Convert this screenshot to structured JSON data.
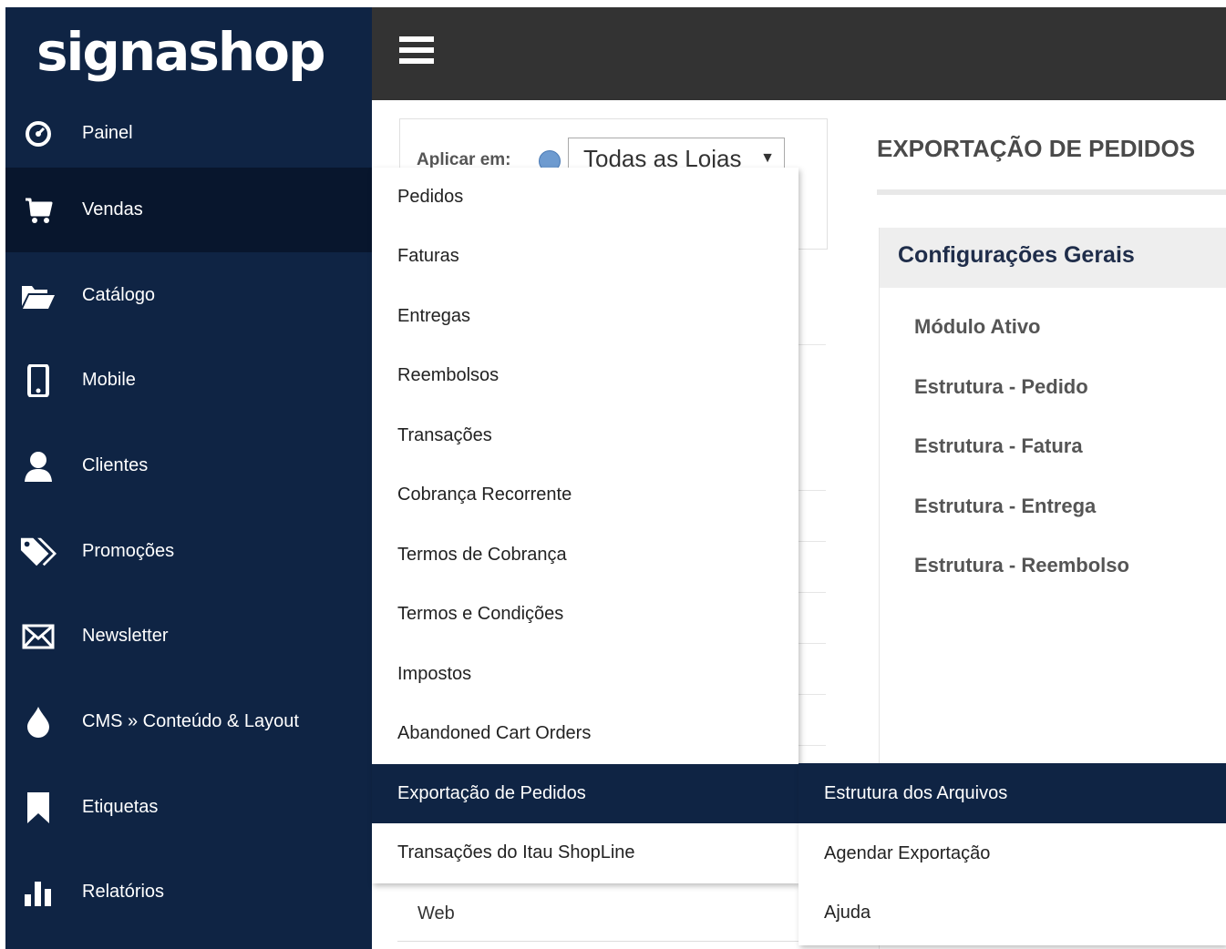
{
  "brand": {
    "logo": "signashop"
  },
  "sidebar": {
    "items": [
      {
        "label": "Painel",
        "icon": "dashboard-icon"
      },
      {
        "label": "Vendas",
        "icon": "cart-icon",
        "active": true
      },
      {
        "label": "Catálogo",
        "icon": "folder-icon"
      },
      {
        "label": "Mobile",
        "icon": "mobile-icon"
      },
      {
        "label": "Clientes",
        "icon": "user-icon"
      },
      {
        "label": "Promoções",
        "icon": "tags-icon"
      },
      {
        "label": "Newsletter",
        "icon": "envelope-icon"
      },
      {
        "label": "CMS » Conteúdo & Layout",
        "icon": "drop-icon"
      },
      {
        "label": "Etiquetas",
        "icon": "bookmark-icon"
      },
      {
        "label": "Relatórios",
        "icon": "bar-chart-icon"
      }
    ]
  },
  "scope": {
    "label": "Aplicar em:",
    "selected": "Todas as Lojas"
  },
  "page": {
    "title": "EXPORTAÇÃO DE PEDIDOS"
  },
  "panel": {
    "title": "Configurações Gerais",
    "fields": [
      "Módulo Ativo",
      "Estrutura - Pedido",
      "Estrutura - Fatura",
      "Estrutura - Entrega",
      "Estrutura - Reembolso"
    ]
  },
  "submenu": {
    "items": [
      {
        "label": "Pedidos"
      },
      {
        "label": "Faturas"
      },
      {
        "label": "Entregas"
      },
      {
        "label": "Reembolsos"
      },
      {
        "label": "Transações"
      },
      {
        "label": "Cobrança Recorrente"
      },
      {
        "label": "Termos de Cobrança"
      },
      {
        "label": "Termos e Condições"
      },
      {
        "label": "Impostos"
      },
      {
        "label": "Abandoned Cart Orders"
      },
      {
        "label": "Exportação de Pedidos",
        "active": true
      },
      {
        "label": "Transações do Itau ShopLine"
      }
    ]
  },
  "flyout": {
    "items": [
      {
        "label": "Estrutura dos Arquivos",
        "active": true
      },
      {
        "label": "Agendar Exportação"
      },
      {
        "label": "Ajuda"
      }
    ]
  },
  "background": {
    "web_label": "Web"
  },
  "colors": {
    "sidebar": "#0f2444",
    "sidebar_active": "#08162d",
    "topbar": "#333333",
    "highlight": "#0f2444"
  }
}
